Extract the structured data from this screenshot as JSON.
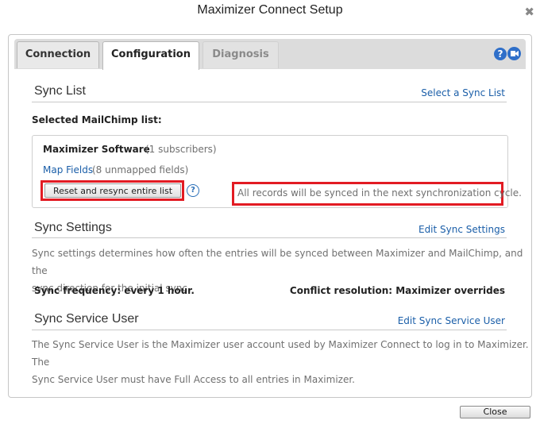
{
  "window": {
    "title": "Maximizer Connect Setup",
    "close_icon": "close-icon",
    "close_glyph": "✖"
  },
  "tabs": [
    {
      "label": "Connection",
      "active": false
    },
    {
      "label": "Configuration",
      "active": true
    },
    {
      "label": "Diagnosis",
      "active": false
    }
  ],
  "header_icons": {
    "help_icon": "help-icon",
    "help_glyph": "?",
    "video_icon": "video-help-icon"
  },
  "sync_list": {
    "title": "Sync List",
    "action_link": "Select a Sync List",
    "selected_label": "Selected MailChimp list:",
    "list_name": "Maximizer Software",
    "list_count": "(1 subscribers)",
    "map_fields_link": "Map Fields",
    "map_fields_count": "(8 unmapped fields)",
    "reset_button": "Reset and resync entire list",
    "help_glyph": "?",
    "notice": "All records will be synced in the next synchronization cycle."
  },
  "sync_settings": {
    "title": "Sync Settings",
    "action_link": "Edit Sync Settings",
    "desc_line1": "Sync settings determines how often the entries will be synced between Maximizer and MailChimp, and the",
    "desc_line2": "sync direction for the initial sync.",
    "frequency": "Sync frequency: every 1 hour.",
    "conflict": "Conflict resolution: Maximizer overrides"
  },
  "sync_service_user": {
    "title": "Sync Service User",
    "action_link": "Edit Sync Service User",
    "desc_line1": "The Sync Service User is the Maximizer user account used by Maximizer Connect to log in to Maximizer. The",
    "desc_line2": "Sync Service User must have Full Access to all entries in Maximizer."
  },
  "footer": {
    "close_button": "Close"
  },
  "colors": {
    "accent_link": "#1a5ea8",
    "highlight_red": "#e21b23",
    "icon_blue": "#2f6fc9"
  }
}
